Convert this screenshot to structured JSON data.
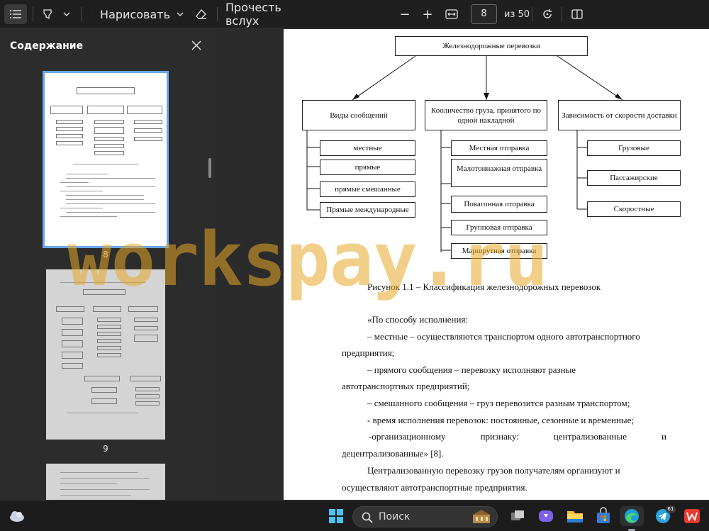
{
  "toolbar": {
    "draw_label": "Нарисовать",
    "read_aloud_label": "Прочесть вслух",
    "minus_label": "−",
    "plus_label": "+",
    "current_page": "8",
    "total_pages": "из 50"
  },
  "sidebar": {
    "title": "Содержание",
    "thumbnails": [
      {
        "page": "8",
        "selected": true
      },
      {
        "page": "9",
        "selected": false
      }
    ]
  },
  "document": {
    "diagram": {
      "root": "Железнодорожные перевозки",
      "columns": [
        {
          "header": "Виды  сообщений",
          "items": [
            "местные",
            "прямые",
            "прямые смешанные",
            "Прямые международные"
          ]
        },
        {
          "header": "Кооличество груза, принятого по одной накладной",
          "items": [
            "Местная отправка",
            "Малотоннажная отправка",
            "Повагонная отправка",
            "Групповая отправка",
            "Маршрутная отправка"
          ]
        },
        {
          "header": "Зависимость от скорости доставки",
          "items": [
            "Грузовые",
            "Пассажирские",
            "Скоростные"
          ]
        }
      ]
    },
    "caption": "Рисунок 1.1 – Классификация железнодорожных перевозок",
    "paragraphs": {
      "p1": "«По способу исполнения:",
      "p2a": "– местные – осуществляются транспортом  одного автотранспортного",
      "p2b": "предприятия;",
      "p3a": "–    прямого    сообщения    –     перевозку    исполняют    разные",
      "p3b": "автотранспортных предприятий;",
      "p4": "– смешанного сообщения – груз перевозится разным транспортом;",
      "p5": "- время исполнения перевозок: постоянные, сезонные и временные;",
      "p6a_1": "-организационному",
      "p6a_2": "признаку:",
      "p6a_3": "централизованные",
      "p6a_4": "и",
      "p6b": "децентрализованные» [8].",
      "p7a": "Централизованную   перевозку грузов получателям   организуют и",
      "p7b": "осуществляют  автотранспортные предприятия."
    }
  },
  "watermark": "workspay.ru",
  "taskbar": {
    "search_label": "Поиск",
    "telegram_badge": "61"
  }
}
